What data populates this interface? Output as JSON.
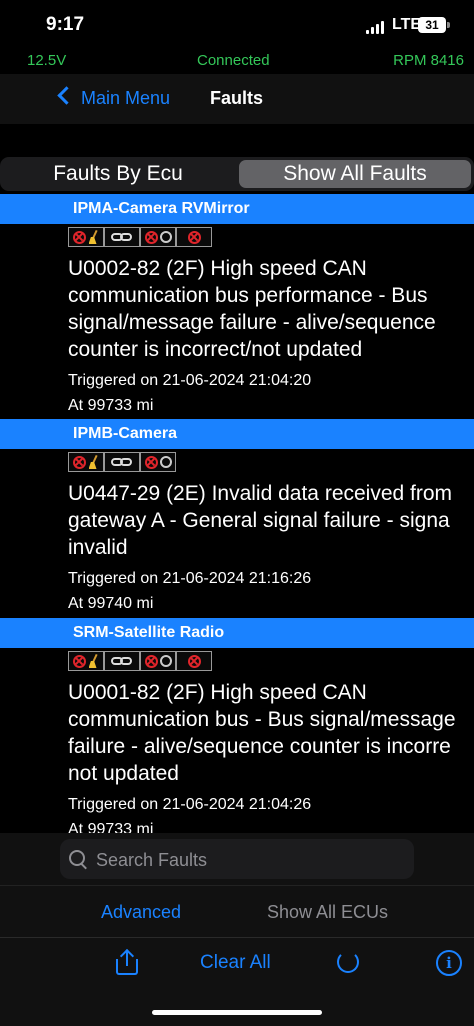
{
  "status_bar": {
    "time": "9:17",
    "network": "LTE",
    "battery": "31"
  },
  "obd": {
    "voltage": "12.5V",
    "connection": "Connected",
    "rpm": "RPM 8416"
  },
  "nav": {
    "back_label": "Main Menu",
    "title": "Faults"
  },
  "segments": [
    {
      "label": "Faults By Ecu",
      "selected": false
    },
    {
      "label": "Show All Faults",
      "selected": true
    }
  ],
  "faults": [
    {
      "ecu": "IPMA-Camera RVMirror",
      "code_lines": [
        "U0002-82 (2F) High speed CAN",
        "communication bus performance - Bus",
        "signal/message failure - alive/sequence",
        "counter is incorrect/not updated"
      ],
      "triggered": "Triggered on 21-06-2024 21:04:20",
      "mileage": "At 99733 mi"
    },
    {
      "ecu": "IPMB-Camera",
      "code_lines": [
        "U0447-29 (2E) Invalid data received from",
        "gateway  A - General signal failure - signa",
        "invalid"
      ],
      "triggered": "Triggered on 21-06-2024 21:16:26",
      "mileage": "At 99740 mi"
    },
    {
      "ecu": "SRM-Satellite Radio",
      "code_lines": [
        "U0001-82 (2F) High speed CAN",
        "communication bus - Bus signal/message",
        "failure - alive/sequence counter is incorre",
        "not updated"
      ],
      "triggered": "Triggered on 21-06-2024 21:04:26",
      "mileage": "At 99733 mi"
    }
  ],
  "search": {
    "placeholder": "Search Faults"
  },
  "bottom_tabs": {
    "advanced": "Advanced",
    "show_all_ecus": "Show All ECUs"
  },
  "toolbar": {
    "clear_all": "Clear All",
    "share_icon": "share-icon",
    "refresh_icon": "refresh-icon",
    "info_icon": "info-icon"
  },
  "colors": {
    "accent": "#1a82ff",
    "obd_green": "#34c759",
    "fault_red": "#e0252b"
  }
}
